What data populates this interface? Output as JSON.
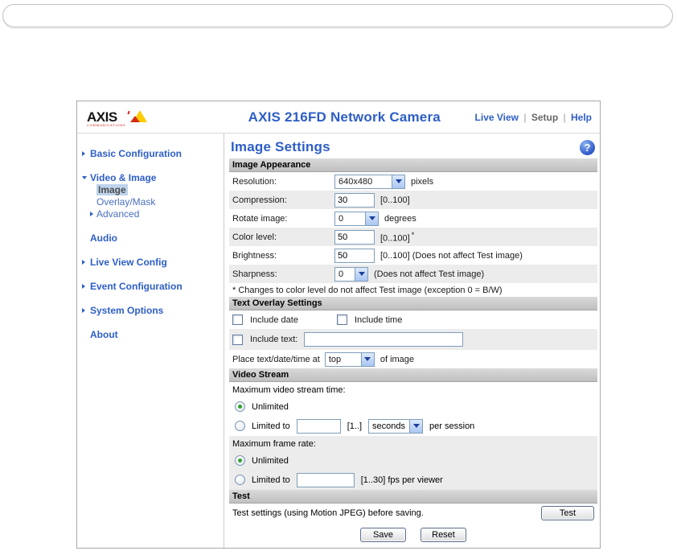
{
  "colors": {
    "accent_blue": "#2d5ec7",
    "row_alt": "#ececec",
    "section_header": "#c9c9c9"
  },
  "header": {
    "logo": {
      "brand": "AXIS",
      "sub": "COMMUNICATIONS"
    },
    "title": "AXIS 216FD Network Camera",
    "nav": {
      "live_view": "Live View",
      "setup": "Setup",
      "help": "Help",
      "sep": "|"
    }
  },
  "sidebar": {
    "basic_configuration": "Basic Configuration",
    "video_image": "Video & Image",
    "image": "Image",
    "overlay_mask": "Overlay/Mask",
    "advanced": "Advanced",
    "audio": "Audio",
    "live_view_config": "Live View Config",
    "event_configuration": "Event Configuration",
    "system_options": "System Options",
    "about": "About"
  },
  "main": {
    "title": "Image Settings",
    "help_glyph": "?",
    "image_appearance": {
      "heading": "Image Appearance",
      "resolution": {
        "label": "Resolution:",
        "value": "640x480",
        "suffix": "pixels"
      },
      "compression": {
        "label": "Compression:",
        "value": "30",
        "suffix": "[0..100]"
      },
      "rotate": {
        "label": "Rotate image:",
        "value": "0",
        "suffix": "degrees"
      },
      "color_level": {
        "label": "Color level:",
        "value": "50",
        "suffix": "[0..100]",
        "asterisk": "*"
      },
      "brightness": {
        "label": "Brightness:",
        "value": "50",
        "suffix": "[0..100] (Does not affect Test image)"
      },
      "sharpness": {
        "label": "Sharpness:",
        "value": "0",
        "suffix": "(Does not affect Test image)"
      },
      "footnote": "* Changes to color level do not affect Test image (exception 0 = B/W)"
    },
    "text_overlay": {
      "heading": "Text Overlay Settings",
      "include_date": "Include date",
      "include_time": "Include time",
      "include_text": "Include text:",
      "include_text_value": "",
      "place_prefix": "Place text/date/time at",
      "place_value": "top",
      "place_suffix": "of image"
    },
    "video_stream": {
      "heading": "Video Stream",
      "max_stream_label": "Maximum video stream time:",
      "unlimited_1": "Unlimited",
      "limited_1": "Limited to",
      "limited_1_value": "",
      "limited_1_range": "[1..]",
      "limited_1_unit": "seconds",
      "limited_1_suffix": "per session",
      "max_frame_label": "Maximum frame rate:",
      "unlimited_2": "Unlimited",
      "limited_2": "Limited to",
      "limited_2_value": "",
      "limited_2_suffix": "[1..30] fps per viewer"
    },
    "test": {
      "heading": "Test",
      "description": "Test settings (using Motion JPEG) before saving.",
      "button": "Test"
    },
    "buttons": {
      "save": "Save",
      "reset": "Reset"
    }
  }
}
